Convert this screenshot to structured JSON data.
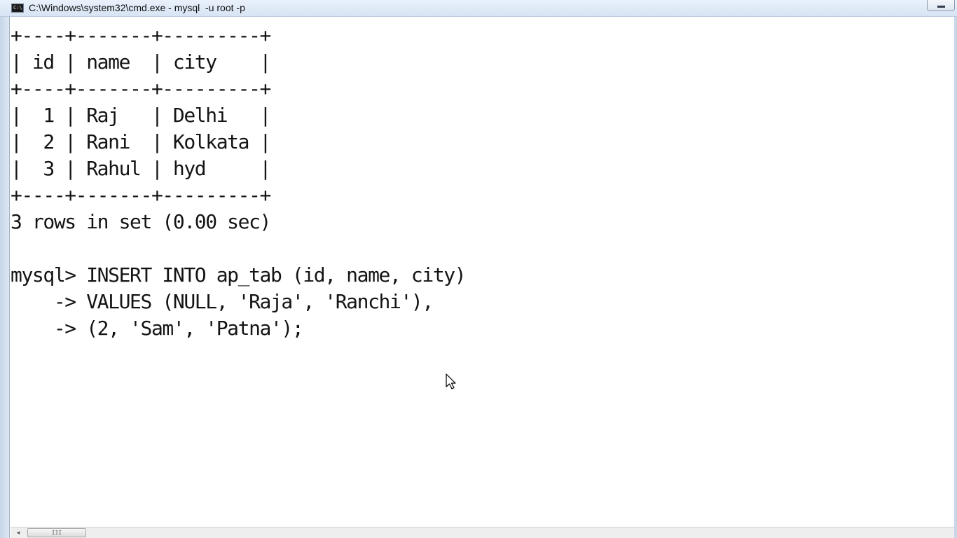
{
  "window": {
    "title": "C:\\Windows\\system32\\cmd.exe - mysql  -u root -p"
  },
  "console": {
    "lines": [
      "+----+-------+---------+",
      "| id | name  | city    |",
      "+----+-------+---------+",
      "|  1 | Raj   | Delhi   |",
      "|  2 | Rani  | Kolkata |",
      "|  3 | Rahul | hyd     |",
      "+----+-------+---------+",
      "3 rows in set (0.00 sec)",
      "",
      "mysql> INSERT INTO ap_tab (id, name, city)",
      "    -> VALUES (NULL, 'Raja', 'Ranchi'),",
      "    -> (2, 'Sam', 'Patna');"
    ]
  },
  "scrollbar": {
    "left_arrow": "◂",
    "thumb_grip": "III"
  },
  "icons": {
    "window_icon": "cmd-icon",
    "minimize": "minimize-icon",
    "cursor": "mouse-pointer-icon"
  }
}
